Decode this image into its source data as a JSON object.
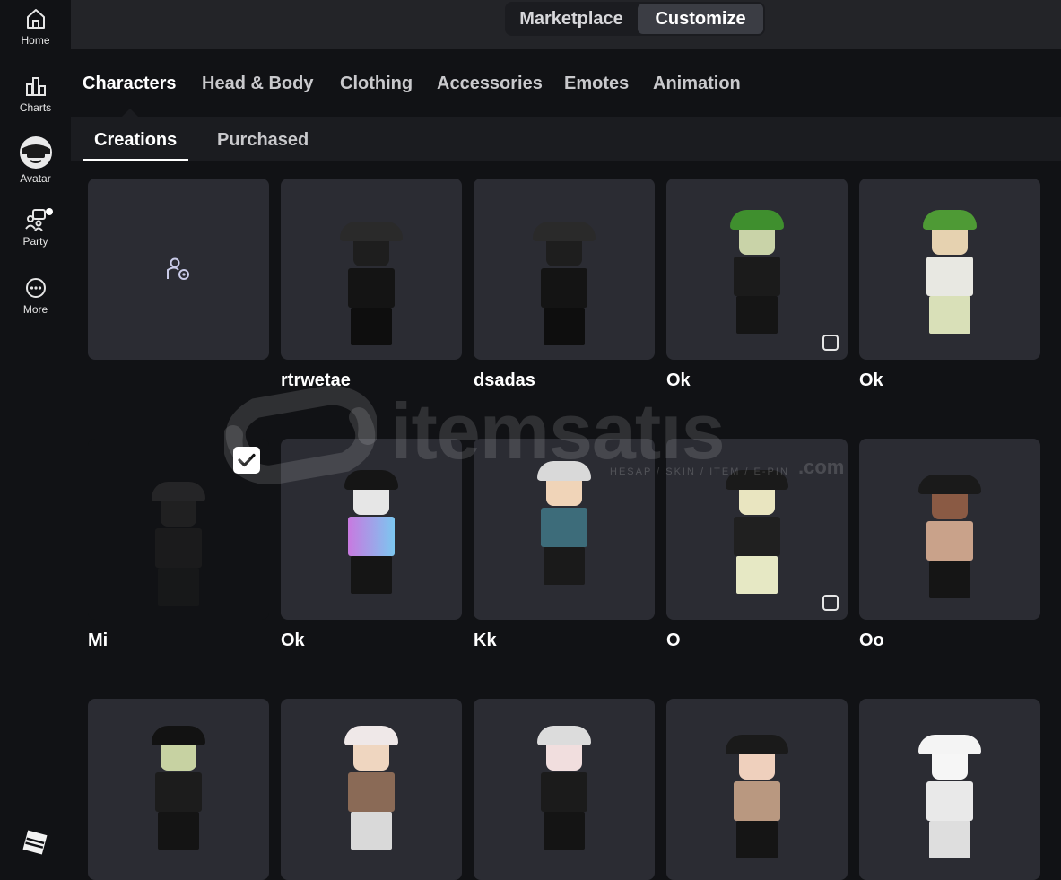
{
  "nav": {
    "items": [
      {
        "label": "Home",
        "icon": "home-icon"
      },
      {
        "label": "Charts",
        "icon": "charts-icon"
      },
      {
        "label": "Avatar",
        "icon": "avatar-icon"
      },
      {
        "label": "Party",
        "icon": "party-icon"
      },
      {
        "label": "More",
        "icon": "more-icon"
      }
    ]
  },
  "top": {
    "marketplace": "Marketplace",
    "customize": "Customize"
  },
  "categories": [
    "Characters",
    "Head & Body",
    "Clothing",
    "Accessories",
    "Emotes",
    "Animation"
  ],
  "subtabs": [
    "Creations",
    "Purchased"
  ],
  "items": [
    {
      "name": "",
      "type": "create"
    },
    {
      "name": "rtrwetae"
    },
    {
      "name": "dsadas"
    },
    {
      "name": "Ok",
      "emote": true
    },
    {
      "name": "Ok"
    },
    {
      "name": "Mi",
      "selected": true
    },
    {
      "name": "Ok"
    },
    {
      "name": "Kk"
    },
    {
      "name": "O",
      "emote": true
    },
    {
      "name": "Oo"
    },
    {
      "name": ""
    },
    {
      "name": ""
    },
    {
      "name": ""
    },
    {
      "name": ""
    },
    {
      "name": ""
    }
  ],
  "watermark": {
    "text": "itemsatıs",
    "sub": "HESAP / SKIN / ITEM / E-PIN",
    "com": ".com"
  },
  "colors": {
    "background": "#111215",
    "card": "#2b2c33",
    "topbar": "#232428",
    "active_segment": "#3b3d44"
  }
}
